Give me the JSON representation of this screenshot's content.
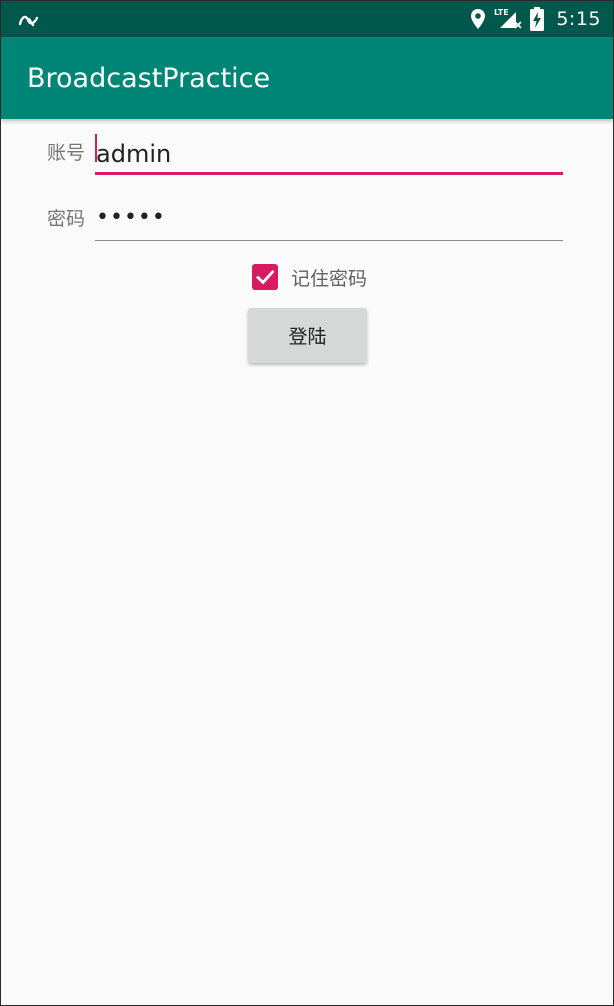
{
  "status_bar": {
    "left_icon": "android-auto-icon",
    "right_icons": [
      "location-icon",
      "lte-signal-icon",
      "battery-charging-icon"
    ],
    "network_label": "LTE",
    "time": "5:15"
  },
  "app_bar": {
    "title": "BroadcastPractice"
  },
  "form": {
    "account": {
      "label": "账号",
      "value": "admin"
    },
    "password": {
      "label": "密码",
      "value": "•••••"
    },
    "remember": {
      "label": "记住密码",
      "checked": true
    },
    "login_button": {
      "label": "登陆"
    }
  },
  "colors": {
    "status_bar": "#00574b",
    "app_bar": "#008577",
    "accent": "#d81b60",
    "background": "#fafafa"
  }
}
